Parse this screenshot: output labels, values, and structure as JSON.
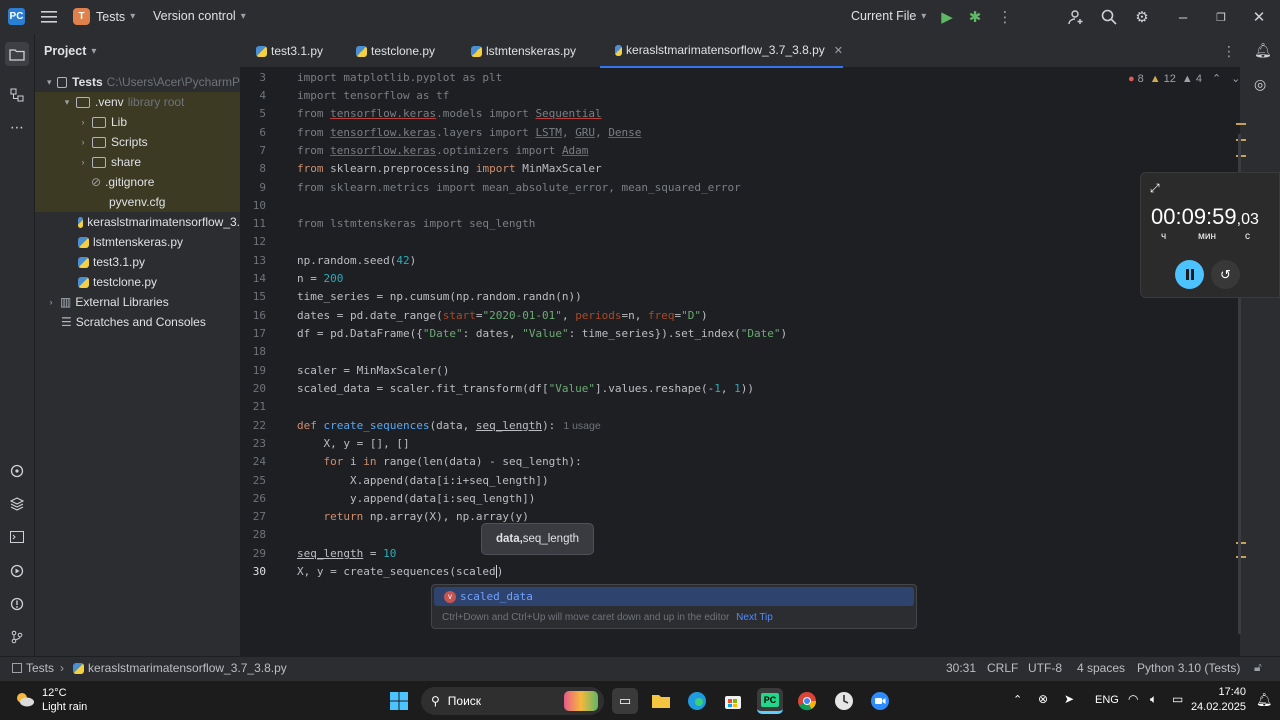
{
  "titlebar": {
    "project_badge": "T",
    "project_name": "Tests",
    "vcs_label": "Version control",
    "run_config": "Current File"
  },
  "project_panel": {
    "title": "Project",
    "items": [
      {
        "label": "Tests",
        "extra": "C:\\Users\\Acer\\PycharmP"
      },
      {
        "label": ".venv",
        "extra": "library root"
      },
      {
        "label": "Lib"
      },
      {
        "label": "Scripts"
      },
      {
        "label": "share"
      },
      {
        "label": ".gitignore"
      },
      {
        "label": "pyvenv.cfg"
      },
      {
        "label": "keraslstmarimatensorflow_3."
      },
      {
        "label": "lstmtenskeras.py"
      },
      {
        "label": "test3.1.py"
      },
      {
        "label": "testclone.py"
      },
      {
        "label": "External Libraries"
      },
      {
        "label": "Scratches and Consoles"
      }
    ]
  },
  "tabs": [
    {
      "label": "test3.1.py"
    },
    {
      "label": "testclone.py"
    },
    {
      "label": "lstmtenskeras.py"
    },
    {
      "label": "keraslstmarimatensorflow_3.7_3.8.py"
    }
  ],
  "inspections": {
    "errors": "8",
    "warnings": "12",
    "weak": "4"
  },
  "line_numbers": [
    "3",
    "4",
    "5",
    "6",
    "7",
    "8",
    "9",
    "10",
    "11",
    "12",
    "13",
    "14",
    "15",
    "16",
    "17",
    "18",
    "19",
    "20",
    "21",
    "22",
    "23",
    "24",
    "25",
    "26",
    "27",
    "28",
    "29",
    "30"
  ],
  "code": {
    "usage_hint": "1 usage"
  },
  "param_hint": {
    "bold": "data,",
    "rest": " seq_length"
  },
  "completion": {
    "item": "scaled_data",
    "tip": "Ctrl+Down and Ctrl+Up will move caret down and up in the editor",
    "next_tip": "Next Tip"
  },
  "timer": {
    "time": "00:09:59",
    "fraction": ",03",
    "unit_h": "ч",
    "unit_m": "мин",
    "unit_s": "с"
  },
  "status": {
    "breadcrumb_root": "Tests",
    "breadcrumb_file": "keraslstmarimatensorflow_3.7_3.8.py",
    "position": "30:31",
    "line_sep": "CRLF",
    "encoding": "UTF-8",
    "indent": "4 spaces",
    "interpreter": "Python 3.10 (Tests)"
  },
  "taskbar": {
    "weather_temp": "12°C",
    "weather_desc": "Light rain",
    "search": "Поиск",
    "lang": "ENG",
    "time": "17:40",
    "date": "24.02.2025"
  }
}
